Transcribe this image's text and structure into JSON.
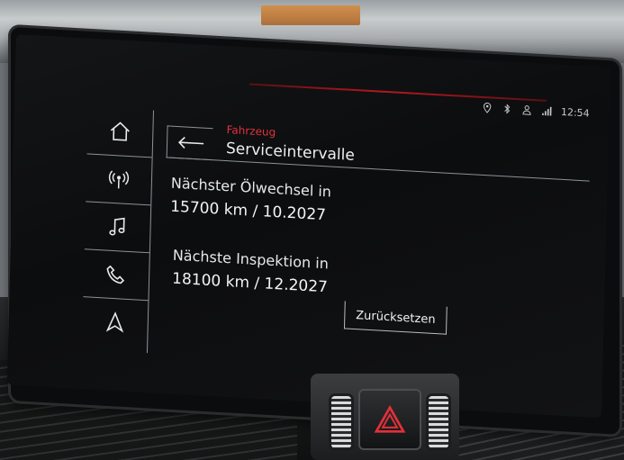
{
  "status_bar": {
    "time": "12:54",
    "icons": [
      "location-pin-icon",
      "bluetooth-icon",
      "user-icon",
      "signal-icon"
    ]
  },
  "nav_rail": {
    "items": [
      {
        "name": "home",
        "icon": "home-icon"
      },
      {
        "name": "radio",
        "icon": "radio-antenna-icon"
      },
      {
        "name": "media",
        "icon": "music-note-icon"
      },
      {
        "name": "phone",
        "icon": "phone-icon"
      },
      {
        "name": "navigation",
        "icon": "navigation-arrow-icon"
      }
    ]
  },
  "header": {
    "breadcrumb": "Fahrzeug",
    "title": "Serviceintervalle",
    "back_icon": "back-arrow-icon"
  },
  "service": {
    "oil_change_label": "Nächster Ölwechsel in",
    "oil_change_value": "15700 km / 10.2027",
    "inspection_label": "Nächste Inspektion in",
    "inspection_value": "18100 km / 12.2027"
  },
  "actions": {
    "reset_label": "Zurücksetzen"
  },
  "colors": {
    "accent_red": "#e0323c",
    "text": "#eceeef",
    "divider": "#8e9295",
    "screen_bg": "#0e0f10"
  }
}
